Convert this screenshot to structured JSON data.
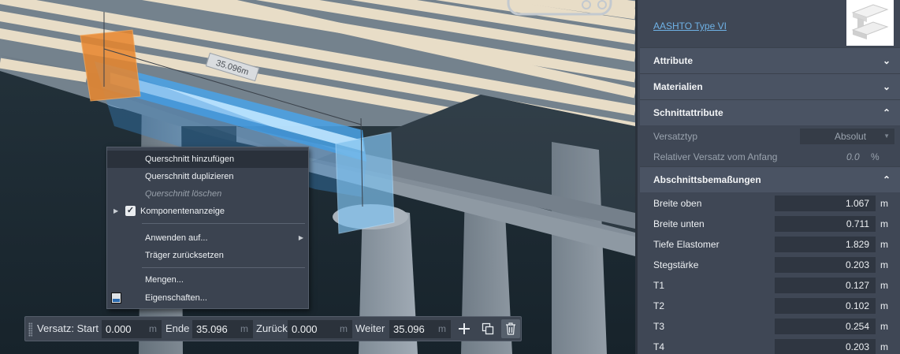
{
  "viewport": {
    "dimension_label": "35.096m"
  },
  "context_menu": {
    "items": [
      {
        "label": "Querschnitt hinzufügen",
        "state": "hover"
      },
      {
        "label": "Querschnitt duplizieren",
        "state": "normal"
      },
      {
        "label": "Querschnitt löschen",
        "state": "disabled"
      },
      {
        "label": "Komponentenanzeige",
        "state": "checked",
        "has_expander": true
      },
      {
        "label": "Anwenden auf...",
        "state": "normal",
        "has_submenu": true
      },
      {
        "label": "Träger zurücksetzen",
        "state": "normal"
      },
      {
        "label": "Mengen...",
        "state": "normal"
      },
      {
        "label": "Eigenschaften...",
        "state": "normal",
        "icon": "properties-icon"
      }
    ]
  },
  "toolbar": {
    "start_label": "Versatz: Start",
    "start_value": "0.000",
    "end_label": "Ende",
    "end_value": "35.096",
    "back_label": "Zurück",
    "back_value": "0.000",
    "forward_label": "Weiter",
    "forward_value": "35.096",
    "unit": "m",
    "buttons": [
      "plus-icon",
      "copy-icon",
      "trash-icon"
    ]
  },
  "panel": {
    "profile_name": "AASHTO Type VI",
    "sections": {
      "attribute": "Attribute",
      "materialien": "Materialien",
      "schnittattribute": "Schnittattribute",
      "abschnitt": "Abschnittsbemaßungen"
    },
    "versatztyp_label": "Versatztyp",
    "versatztyp_value": "Absolut",
    "rel_versatz_label": "Relativer Versatz vom Anfang",
    "rel_versatz_value": "0.0",
    "rel_versatz_unit": "%",
    "dimensions": [
      {
        "label": "Breite oben",
        "value": "1.067",
        "unit": "m"
      },
      {
        "label": "Breite unten",
        "value": "0.711",
        "unit": "m"
      },
      {
        "label": "Tiefe Elastomer",
        "value": "1.829",
        "unit": "m"
      },
      {
        "label": "Stegstärke",
        "value": "0.203",
        "unit": "m"
      },
      {
        "label": "T1",
        "value": "0.127",
        "unit": "m"
      },
      {
        "label": "T2",
        "value": "0.102",
        "unit": "m"
      },
      {
        "label": "T3",
        "value": "0.254",
        "unit": "m"
      },
      {
        "label": "T4",
        "value": "0.203",
        "unit": "m"
      }
    ]
  },
  "colors": {
    "panel_bg": "#3f4755",
    "section_header": "#4a5363",
    "link": "#6fb2e6",
    "girder_highlight": "#4aa3e8",
    "start_plane": "#e9862c",
    "end_plane": "#7fc1ee"
  }
}
